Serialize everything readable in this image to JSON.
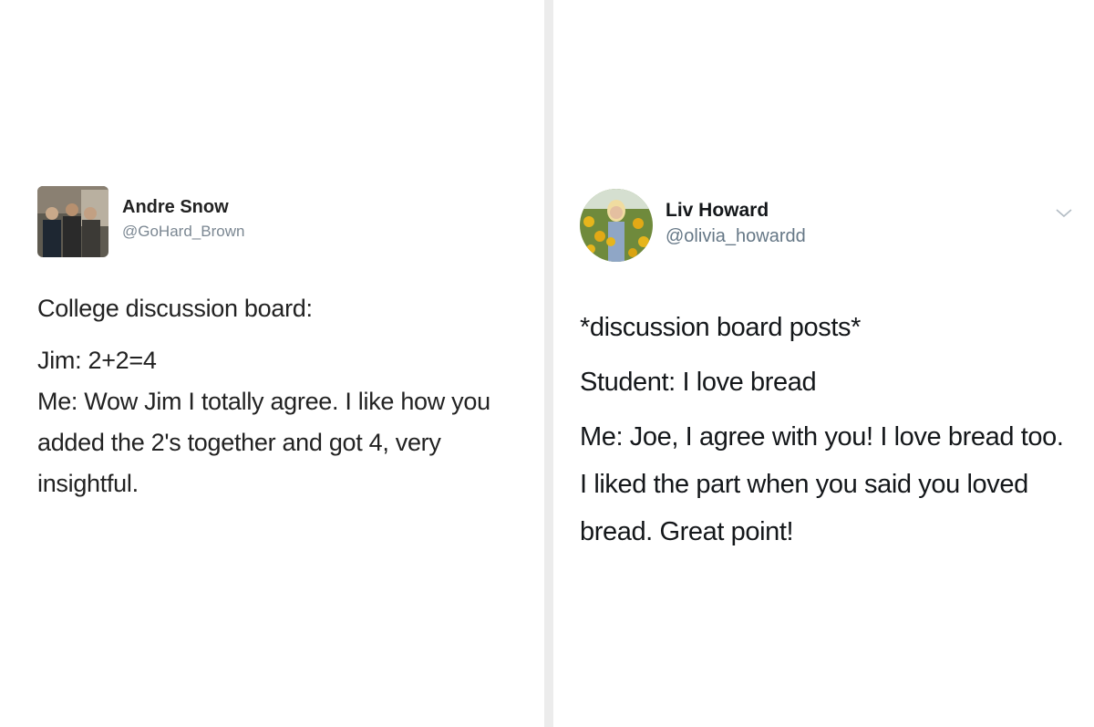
{
  "left_tweet": {
    "author_name": "Andre Snow",
    "handle": "@GoHard_Brown",
    "lines": [
      "College discussion board:",
      "Jim: 2+2=4",
      "Me: Wow Jim I totally agree. I like how you added the 2's together and got 4, very insightful."
    ]
  },
  "right_tweet": {
    "author_name": "Liv Howard",
    "handle": "@olivia_howardd",
    "lines": [
      "*discussion board posts*",
      "Student: I love bread",
      "Me: Joe, I agree with you! I love bread too. I liked the part when you said you loved bread. Great point!"
    ]
  },
  "icons": {
    "left_avatar": "group-photo-avatar",
    "right_avatar": "sunflower-field-avatar",
    "menu": "chevron-down-icon"
  },
  "colors": {
    "divider": "#ececec",
    "handle_left": "#7b8792",
    "handle_right": "#657786",
    "text": "#14171a"
  }
}
